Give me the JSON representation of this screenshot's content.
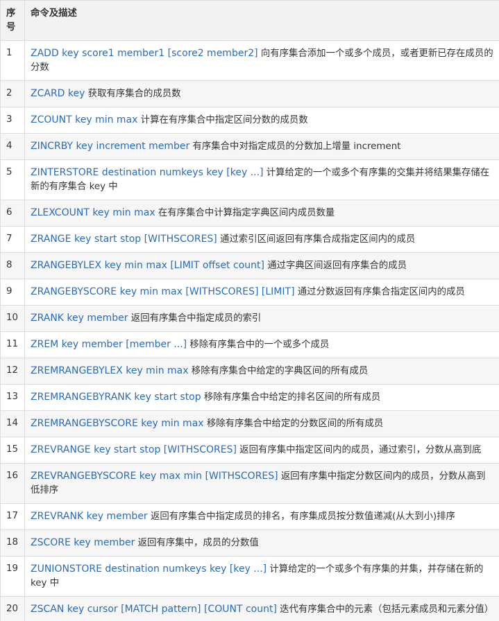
{
  "headers": {
    "num": "序号",
    "desc": "命令及描述"
  },
  "rows": [
    {
      "num": "1",
      "cmd": "ZADD key score1 member1 [score2 member2]",
      "desc": " 向有序集合添加一个或多个成员，或者更新已存在成员的分数"
    },
    {
      "num": "2",
      "cmd": "ZCARD key",
      "desc": " 获取有序集合的成员数"
    },
    {
      "num": "3",
      "cmd": "ZCOUNT key min max",
      "desc": " 计算在有序集合中指定区间分数的成员数"
    },
    {
      "num": "4",
      "cmd": "ZINCRBY key increment member",
      "desc": " 有序集合中对指定成员的分数加上增量 increment"
    },
    {
      "num": "5",
      "cmd": "ZINTERSTORE destination numkeys key [key ...]",
      "desc": " 计算给定的一个或多个有序集的交集并将结果集存储在新的有序集合 key 中"
    },
    {
      "num": "6",
      "cmd": "ZLEXCOUNT key min max",
      "desc": " 在有序集合中计算指定字典区间内成员数量"
    },
    {
      "num": "7",
      "cmd": "ZRANGE key start stop [WITHSCORES]",
      "desc": " 通过索引区间返回有序集合成指定区间内的成员"
    },
    {
      "num": "8",
      "cmd": "ZRANGEBYLEX key min max [LIMIT offset count]",
      "desc": " 通过字典区间返回有序集合的成员"
    },
    {
      "num": "9",
      "cmd": "ZRANGEBYSCORE key min max [WITHSCORES] [LIMIT]",
      "desc": " 通过分数返回有序集合指定区间内的成员"
    },
    {
      "num": "10",
      "cmd": "ZRANK key member",
      "desc": " 返回有序集合中指定成员的索引"
    },
    {
      "num": "11",
      "cmd": "ZREM key member [member ...]",
      "desc": " 移除有序集合中的一个或多个成员"
    },
    {
      "num": "12",
      "cmd": "ZREMRANGEBYLEX key min max",
      "desc": " 移除有序集合中给定的字典区间的所有成员"
    },
    {
      "num": "13",
      "cmd": "ZREMRANGEBYRANK key start stop",
      "desc": " 移除有序集合中给定的排名区间的所有成员"
    },
    {
      "num": "14",
      "cmd": "ZREMRANGEBYSCORE key min max",
      "desc": " 移除有序集合中给定的分数区间的所有成员"
    },
    {
      "num": "15",
      "cmd": "ZREVRANGE key start stop [WITHSCORES]",
      "desc": " 返回有序集中指定区间内的成员，通过索引，分数从高到底"
    },
    {
      "num": "16",
      "cmd": "ZREVRANGEBYSCORE key max min [WITHSCORES]",
      "desc": " 返回有序集中指定分数区间内的成员，分数从高到低排序"
    },
    {
      "num": "17",
      "cmd": "ZREVRANK key member",
      "desc": " 返回有序集合中指定成员的排名，有序集成员按分数值递减(从大到小)排序"
    },
    {
      "num": "18",
      "cmd": "ZSCORE key member",
      "desc": " 返回有序集中，成员的分数值"
    },
    {
      "num": "19",
      "cmd": "ZUNIONSTORE destination numkeys key [key ...]",
      "desc": " 计算给定的一个或多个有序集的并集，并存储在新的 key 中"
    },
    {
      "num": "20",
      "cmd": "ZSCAN key cursor [MATCH pattern] [COUNT count]",
      "desc": " 迭代有序集合中的元素（包括元素成员和元素分值）"
    }
  ]
}
